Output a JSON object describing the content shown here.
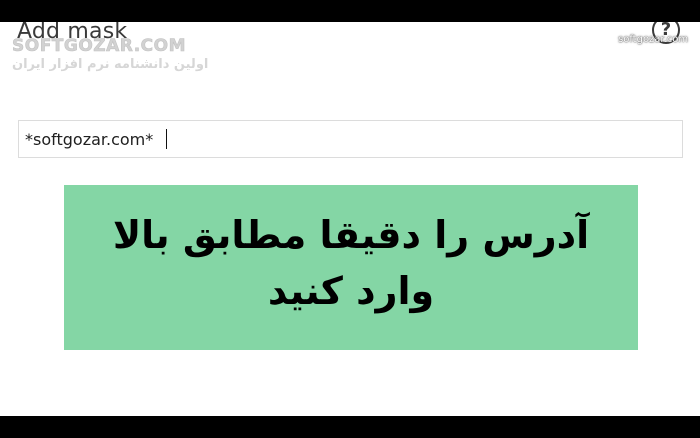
{
  "dialog": {
    "title": "Add mask",
    "help_label": "?"
  },
  "mask_input": {
    "value": "*softgozar.com*"
  },
  "instruction": {
    "text": "آدرس را دقیقا مطابق بالا وارد کنید"
  },
  "watermark": {
    "brand": "SOFTGOZAR.COM",
    "tagline": "اولین دانشنامه نرم افزار ایران",
    "corner": "softgozar.com"
  },
  "colors": {
    "instruction_bg": "#84d6a5",
    "letterbox": "#000000",
    "window_bg": "#ffffff"
  }
}
